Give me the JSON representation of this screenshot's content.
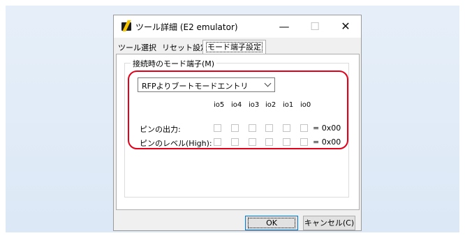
{
  "window": {
    "title": "ツール詳細 (E2 emulator)",
    "controls": {
      "minimize": "—",
      "maximize": "☐",
      "close": "✕"
    }
  },
  "tabs": [
    {
      "label": "ツール選択"
    },
    {
      "label": "リセット設定"
    },
    {
      "label": "モード端子設定",
      "active": true
    }
  ],
  "group": {
    "title": "接続時のモード端子(M)",
    "mode_select": {
      "value": "RFPよりブートモードエントリ"
    },
    "pins": [
      "io5",
      "io4",
      "io3",
      "io2",
      "io1",
      "io0"
    ],
    "rows": [
      {
        "label": "ピンの出力:",
        "value": "= 0x00"
      },
      {
        "label": "ピンのレベル(High):",
        "value": "= 0x00"
      }
    ]
  },
  "buttons": {
    "ok": "OK",
    "cancel": "キャンセル(C)"
  },
  "colors": {
    "highlight": "#e2001a",
    "ok_border": "#0078d7"
  }
}
